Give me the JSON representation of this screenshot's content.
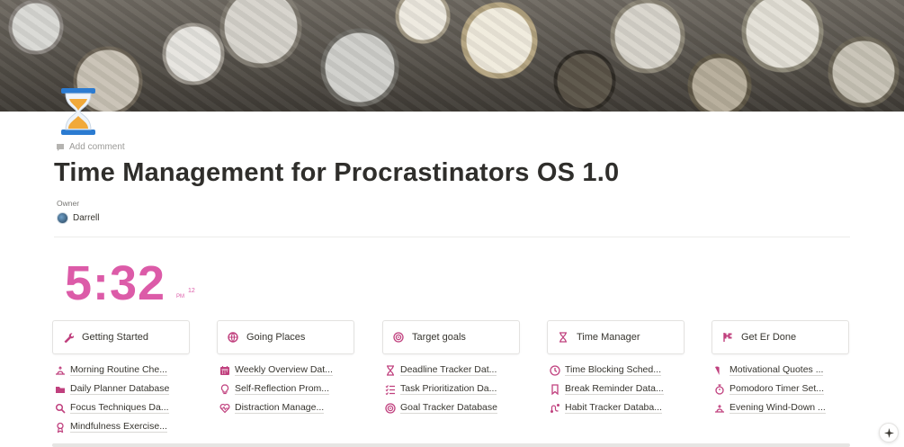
{
  "page": {
    "add_comment": "Add comment",
    "title": "Time Management for Procrastinators OS 1.0",
    "owner_label": "Owner",
    "owner_name": "Darrell"
  },
  "clock": {
    "time": "5:32",
    "ampm": "PM",
    "seconds": "12",
    "color": "#dc5ba8"
  },
  "icons_color": "#c0407e",
  "columns": [
    {
      "header": "Getting Started",
      "header_icon": "wrench-icon",
      "links": [
        {
          "label": "Morning Routine Che...",
          "icon": "sunrise-icon"
        },
        {
          "label": "Daily Planner Database",
          "icon": "folder-icon"
        },
        {
          "label": "Focus Techniques Da...",
          "icon": "search-icon"
        },
        {
          "label": "Mindfulness Exercise...",
          "icon": "award-icon"
        }
      ]
    },
    {
      "header": "Going Places",
      "header_icon": "globe-icon",
      "links": [
        {
          "label": "Weekly Overview Dat...",
          "icon": "calendar-icon"
        },
        {
          "label": "Self-Reflection Prom...",
          "icon": "lightbulb-icon"
        },
        {
          "label": "Distraction Manage...",
          "icon": "heart-pulse-icon"
        }
      ]
    },
    {
      "header": "Target goals",
      "header_icon": "target-icon",
      "links": [
        {
          "label": "Deadline Tracker Dat...",
          "icon": "hourglass-icon"
        },
        {
          "label": "Task Prioritization Da...",
          "icon": "checklist-icon"
        },
        {
          "label": "Goal Tracker Database",
          "icon": "target-icon"
        }
      ]
    },
    {
      "header": "Time Manager",
      "header_icon": "hourglass-icon",
      "links": [
        {
          "label": "Time Blocking Sched...",
          "icon": "clock-icon"
        },
        {
          "label": "Break Reminder Data...",
          "icon": "bookmark-icon"
        },
        {
          "label": "Habit Tracker Databa...",
          "icon": "route-icon"
        }
      ]
    },
    {
      "header": "Get Er Done",
      "header_icon": "flag-icon",
      "links": [
        {
          "label": "Motivational Quotes ...",
          "icon": "book-icon"
        },
        {
          "label": "Pomodoro Timer Set...",
          "icon": "stopwatch-icon"
        },
        {
          "label": "Evening Wind-Down ...",
          "icon": "sunset-icon"
        }
      ]
    }
  ]
}
